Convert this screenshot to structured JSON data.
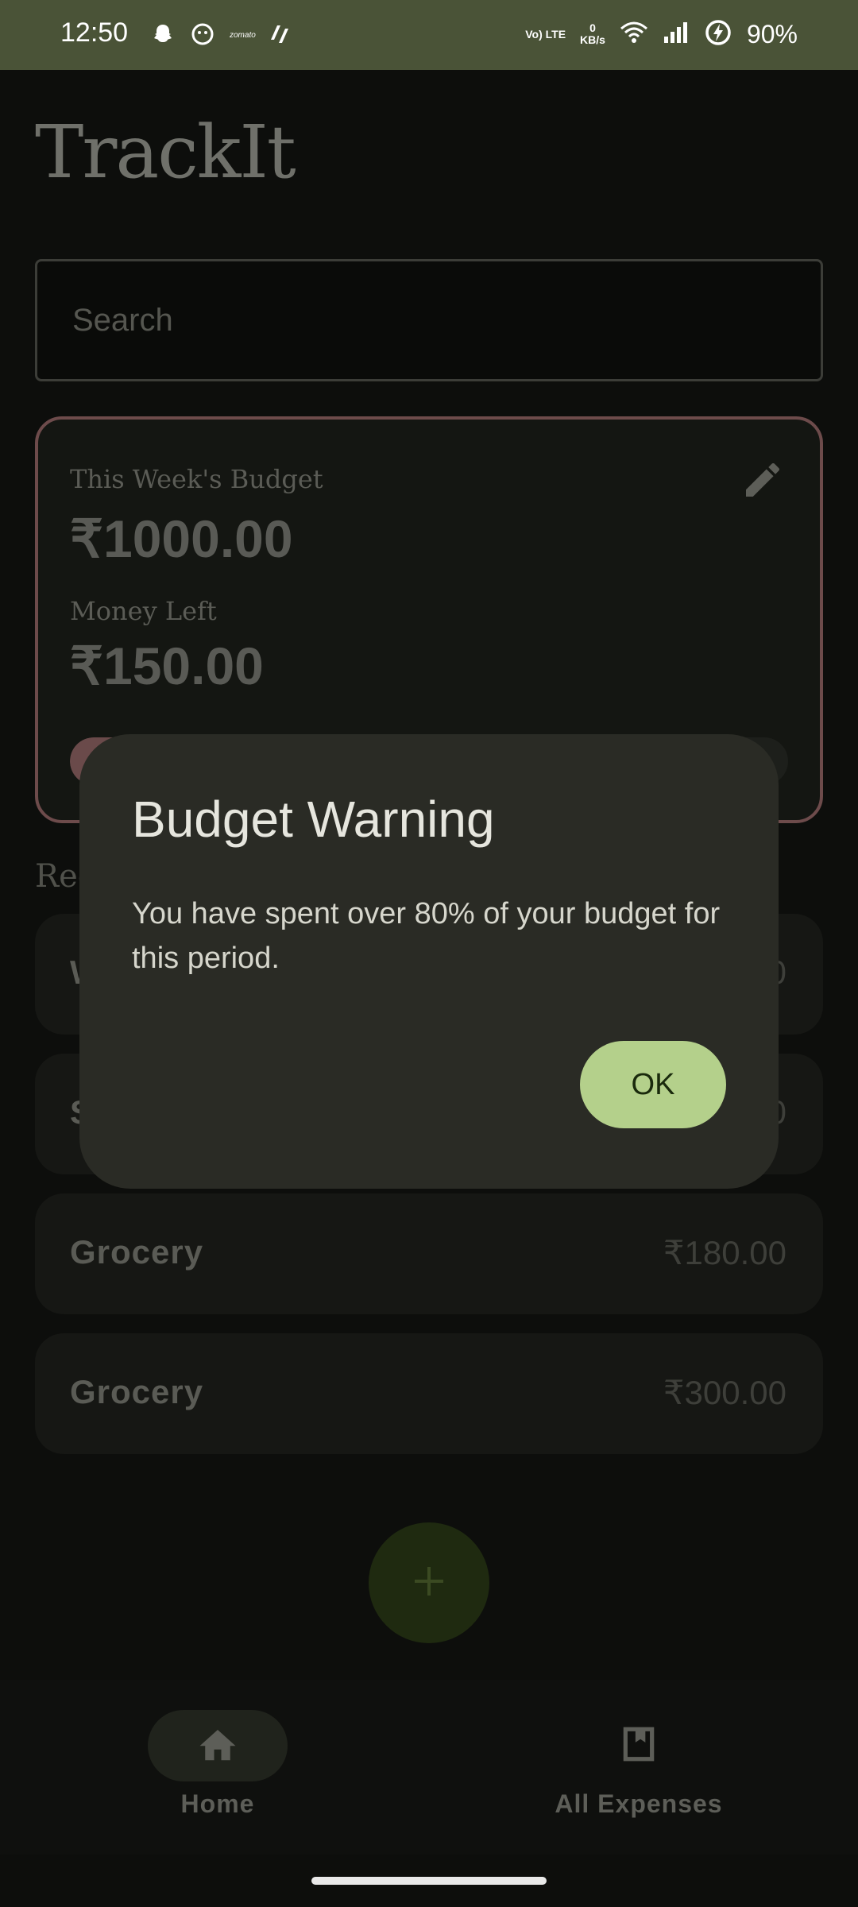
{
  "status_bar": {
    "time": "12:50",
    "notification_icons": [
      "snapchat-icon",
      "ghost-icon",
      "zomato-icon",
      "app-icon"
    ],
    "lte_label": "Vo) LTE",
    "data_rate_value": "0",
    "data_rate_unit": "KB/s",
    "battery": "90%"
  },
  "app": {
    "title": "TrackIt",
    "search": {
      "placeholder": "Search"
    },
    "budget_card": {
      "budget_label": "This Week's Budget",
      "budget_amount": "₹1000.00",
      "left_label": "Money Left",
      "left_amount": "₹150.00",
      "spent_fraction": 0.85
    },
    "recent_label_visible": "Rec",
    "expenses": [
      {
        "name": "W",
        "price": "0"
      },
      {
        "name": "S",
        "price": "0"
      },
      {
        "name": "Grocery",
        "price": "₹180.00"
      },
      {
        "name": "Grocery",
        "price": "₹300.00"
      }
    ],
    "fab_icon": "plus-icon"
  },
  "bottom_nav": {
    "items": [
      {
        "label": "Home",
        "icon": "home-icon",
        "active": true
      },
      {
        "label": "All Expenses",
        "icon": "bookmark-icon",
        "active": false
      }
    ]
  },
  "dialog": {
    "title": "Budget Warning",
    "message": "You have spent over 80% of your budget for this period.",
    "ok_label": "OK"
  },
  "colors": {
    "status_bar_bg": "#4a5337",
    "ok_button": "#b4d08b",
    "budget_card_border": "#6d4b4b",
    "dialog_bg": "#2a2b25"
  }
}
